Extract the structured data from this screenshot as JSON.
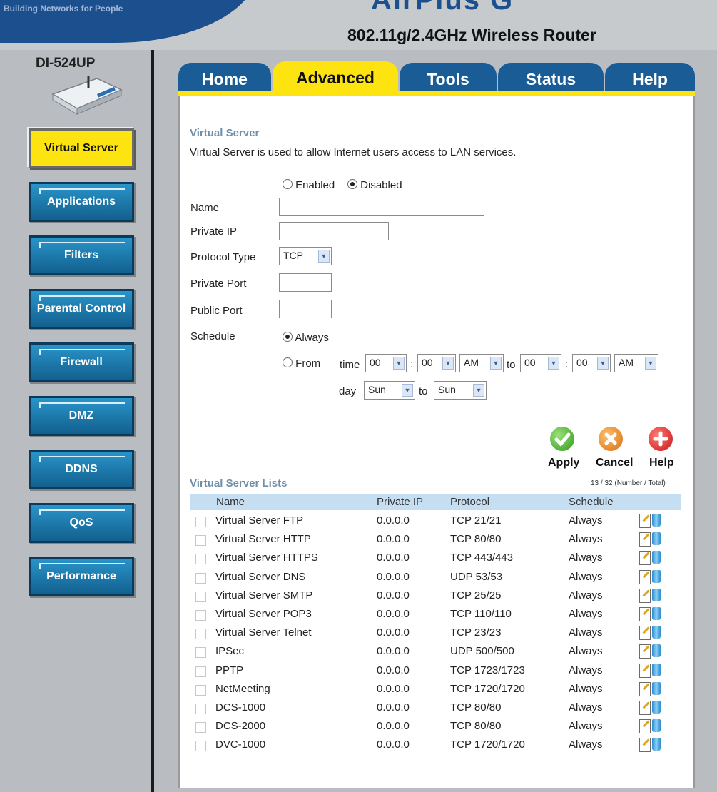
{
  "header": {
    "tagline": "Building Networks for People",
    "brand": "AirPlus G",
    "title": "802.11g/2.4GHz Wireless Router"
  },
  "sidebar": {
    "model": "DI-524UP",
    "items": [
      {
        "label": "Virtual Server",
        "active": true
      },
      {
        "label": "Applications",
        "active": false
      },
      {
        "label": "Filters",
        "active": false
      },
      {
        "label": "Parental Control",
        "active": false
      },
      {
        "label": "Firewall",
        "active": false
      },
      {
        "label": "DMZ",
        "active": false
      },
      {
        "label": "DDNS",
        "active": false
      },
      {
        "label": "QoS",
        "active": false
      },
      {
        "label": "Performance",
        "active": false
      }
    ]
  },
  "tabs": [
    {
      "label": "Home",
      "active": false
    },
    {
      "label": "Advanced",
      "active": true
    },
    {
      "label": "Tools",
      "active": false
    },
    {
      "label": "Status",
      "active": false
    },
    {
      "label": "Help",
      "active": false
    }
  ],
  "form": {
    "section_title": "Virtual Server",
    "description": "Virtual Server is used to allow Internet users access to LAN services.",
    "enabled_label": "Enabled",
    "disabled_label": "Disabled",
    "state": "Disabled",
    "name_label": "Name",
    "name_value": "",
    "private_ip_label": "Private IP",
    "private_ip_value": "",
    "protocol_label": "Protocol Type",
    "protocol_value": "TCP",
    "private_port_label": "Private Port",
    "private_port_value": "",
    "public_port_label": "Public Port",
    "public_port_value": "",
    "schedule_label": "Schedule",
    "always_label": "Always",
    "from_label": "From",
    "time_label": "time",
    "to_label": "to",
    "day_label": "day",
    "colon": ":",
    "start_hour": "00",
    "start_min": "00",
    "start_ampm": "AM",
    "end_hour": "00",
    "end_min": "00",
    "end_ampm": "AM",
    "start_day": "Sun",
    "end_day": "Sun"
  },
  "actions": {
    "apply": "Apply",
    "cancel": "Cancel",
    "help": "Help"
  },
  "list": {
    "title": "Virtual Server Lists",
    "count": "13 / 32 (Number / Total)",
    "columns": [
      "Name",
      "Private IP",
      "Protocol",
      "Schedule"
    ],
    "rows": [
      {
        "name": "Virtual Server FTP",
        "ip": "0.0.0.0",
        "protocol": "TCP 21/21",
        "schedule": "Always"
      },
      {
        "name": "Virtual Server HTTP",
        "ip": "0.0.0.0",
        "protocol": "TCP 80/80",
        "schedule": "Always"
      },
      {
        "name": "Virtual Server HTTPS",
        "ip": "0.0.0.0",
        "protocol": "TCP 443/443",
        "schedule": "Always"
      },
      {
        "name": "Virtual Server DNS",
        "ip": "0.0.0.0",
        "protocol": "UDP 53/53",
        "schedule": "Always"
      },
      {
        "name": "Virtual Server SMTP",
        "ip": "0.0.0.0",
        "protocol": "TCP 25/25",
        "schedule": "Always"
      },
      {
        "name": "Virtual Server POP3",
        "ip": "0.0.0.0",
        "protocol": "TCP 110/110",
        "schedule": "Always"
      },
      {
        "name": "Virtual Server Telnet",
        "ip": "0.0.0.0",
        "protocol": "TCP 23/23",
        "schedule": "Always"
      },
      {
        "name": "IPSec",
        "ip": "0.0.0.0",
        "protocol": "UDP 500/500",
        "schedule": "Always"
      },
      {
        "name": "PPTP",
        "ip": "0.0.0.0",
        "protocol": "TCP 1723/1723",
        "schedule": "Always"
      },
      {
        "name": "NetMeeting",
        "ip": "0.0.0.0",
        "protocol": "TCP 1720/1720",
        "schedule": "Always"
      },
      {
        "name": "DCS-1000",
        "ip": "0.0.0.0",
        "protocol": "TCP 80/80",
        "schedule": "Always"
      },
      {
        "name": "DCS-2000",
        "ip": "0.0.0.0",
        "protocol": "TCP 80/80",
        "schedule": "Always"
      },
      {
        "name": "DVC-1000",
        "ip": "0.0.0.0",
        "protocol": "TCP 1720/1720",
        "schedule": "Always"
      }
    ]
  },
  "colors": {
    "tab_blue": "#1a5d96",
    "active_yellow": "#fde30f",
    "section_title": "#6f8fa8",
    "list_header": "#c6def2"
  }
}
